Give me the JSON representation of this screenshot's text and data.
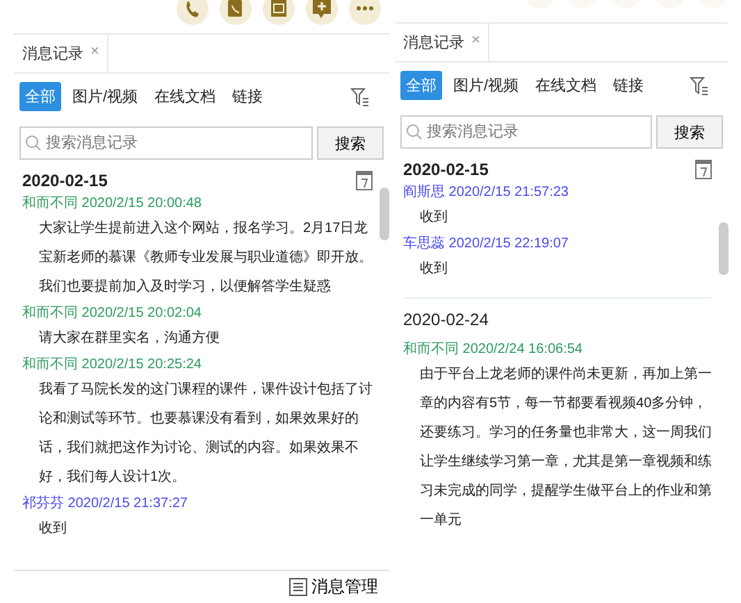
{
  "panels": [
    {
      "toolbar_cut": false,
      "tab": {
        "label": "消息记录",
        "close": "×"
      },
      "filters": [
        {
          "label": "全部",
          "selected": true
        },
        {
          "label": "图片/视频",
          "selected": false
        },
        {
          "label": "在线文档",
          "selected": false
        },
        {
          "label": "链接",
          "selected": false
        }
      ],
      "search": {
        "placeholder": "搜索消息记录",
        "button": "搜索"
      },
      "groups": [
        {
          "kind": "pinned",
          "date": "2020-02-15",
          "messages": [
            {
              "sender": "和而不同",
              "time": "2020/2/15 20:00:48",
              "color": "#2e9b5e",
              "text": "大家让学生提前进入这个网站，报名学习。2月17日龙宝新老师的慕课《教师专业发展与职业道德》即开放。我们也要提前加入及时学习，以便解答学生疑惑"
            },
            {
              "sender": "和而不同",
              "time": "2020/2/15 20:02:04",
              "color": "#2e9b5e",
              "text": "请大家在群里实名，沟通方便"
            },
            {
              "sender": "和而不同",
              "time": "2020/2/15 20:25:24",
              "color": "#2e9b5e",
              "text": "我看了马院长发的这门课程的课件，课件设计包括了讨论和测试等环节。也要慕课没有看到，如果效果好的话，我们就把这作为讨论、测试的内容。如果效果不好，我们每人设计1次。"
            },
            {
              "sender": "祁芬芬",
              "time": "2020/2/15 21:37:27",
              "color": "#4a4af0",
              "text": "收到"
            }
          ]
        }
      ],
      "footer": "消息管理"
    },
    {
      "toolbar_cut": true,
      "tab": {
        "label": "消息记录",
        "close": "×"
      },
      "filters": [
        {
          "label": "全部",
          "selected": true
        },
        {
          "label": "图片/视频",
          "selected": false
        },
        {
          "label": "在线文档",
          "selected": false
        },
        {
          "label": "链接",
          "selected": false
        }
      ],
      "search": {
        "placeholder": "搜索消息记录",
        "button": "搜索"
      },
      "groups": [
        {
          "kind": "pinned",
          "date": "2020-02-15",
          "messages": [
            {
              "sender": "阎斯思",
              "time": "2020/2/15 21:57:23",
              "color": "#4a4af0",
              "text": "收到"
            },
            {
              "sender": "车思蕊",
              "time": "2020/2/15 22:19:07",
              "color": "#4a4af0",
              "text": "收到"
            }
          ]
        },
        {
          "kind": "inline",
          "date": "2020-02-24",
          "messages": [
            {
              "sender": "和而不同",
              "time": "2020/2/24 16:06:54",
              "color": "#2e9b5e",
              "text": "由于平台上龙老师的课件尚未更新，再加上第一章的内容有5节，每一节都要看视频40多分钟，还要练习。学习的任务量也非常大，这一周我们让学生继续学习第一章，尤其是第一章视频和练习未完成的同学，提醒学生做平台上的作业和第一单元"
            }
          ]
        }
      ]
    }
  ]
}
